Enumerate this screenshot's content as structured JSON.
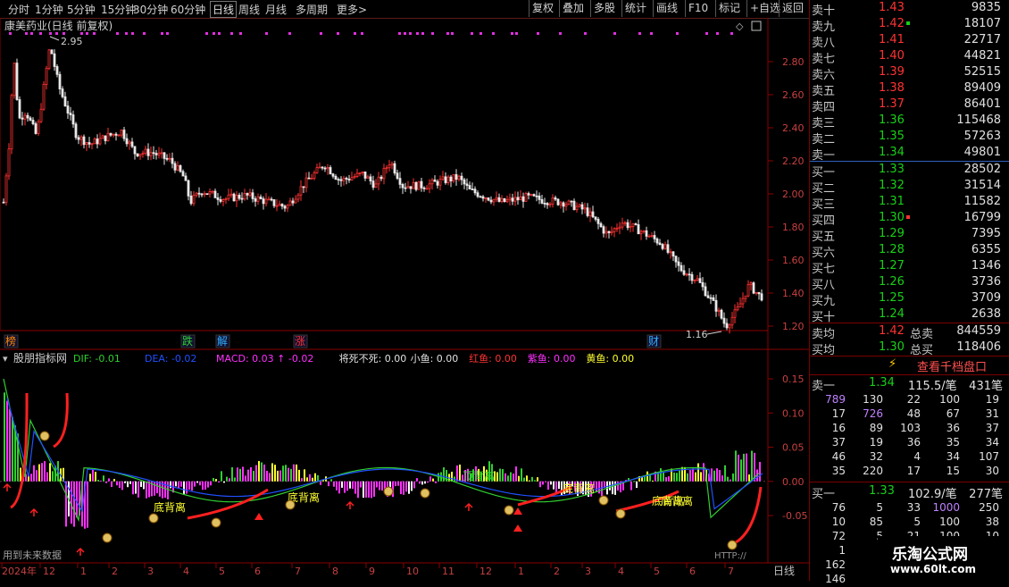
{
  "toolbar": {
    "periods": [
      "分时",
      "1分钟",
      "5分钟",
      "15分钟",
      "30分钟",
      "60分钟",
      "日线",
      "周线",
      "月线",
      "多周期",
      "更多>"
    ],
    "active": "日线",
    "right_buttons": [
      "复权",
      "叠加",
      "多股",
      "统计",
      "画线",
      "F10",
      "标记",
      "+自选",
      "返回"
    ]
  },
  "main_chart": {
    "title": "康美药业(日线 前复权)",
    "high_label": "2.95",
    "low_label": "1.16",
    "y_ticks": [
      "2.80",
      "2.60",
      "2.40",
      "2.20",
      "2.00",
      "1.80",
      "1.60",
      "1.40",
      "1.20"
    ],
    "markers": [
      "榜",
      "跌",
      "解",
      "涨",
      "财"
    ]
  },
  "indicator": {
    "name": "股朋指标网",
    "fields": [
      {
        "label": "DIF: -0.01",
        "color": "#30d030"
      },
      {
        "label": "DEA: -0.02",
        "color": "#2050ff"
      },
      {
        "label": "MACD: 0.03 ↑ -0.02",
        "color": "#ff30ff"
      },
      {
        "label": "将死不死: 0.00",
        "color": "#e0e0e0"
      },
      {
        "label": "小鱼: 0.00",
        "color": "#e0e0e0"
      },
      {
        "label": "红鱼: 0.00",
        "color": "#ff3232"
      },
      {
        "label": "紫鱼: 0.00",
        "color": "#ff30ff"
      },
      {
        "label": "黄鱼: 0.00",
        "color": "#ffff30"
      }
    ],
    "y_ticks": [
      "0.15",
      "0.10",
      "0.05",
      "0.00",
      "-0.05"
    ],
    "annotations": [
      "底背离",
      "底背离",
      "顶背离",
      "底背离",
      "底背离",
      "底背离"
    ],
    "footer_left": "用到未来数据",
    "footer_right": "HTTP://"
  },
  "x_axis": {
    "labels": [
      "2024年",
      "12",
      "1",
      "2",
      "3",
      "4",
      "5",
      "6",
      "7",
      "8",
      "9",
      "10",
      "11",
      "12",
      "1",
      "2",
      "3",
      "4",
      "5",
      "6",
      "7"
    ],
    "period": "日线"
  },
  "order_book": {
    "sell": [
      {
        "label": "卖十",
        "price": "1.43",
        "vol": "9835"
      },
      {
        "label": "卖九",
        "price": "1.42",
        "vol": "18107"
      },
      {
        "label": "卖八",
        "price": "1.41",
        "vol": "22717"
      },
      {
        "label": "卖七",
        "price": "1.40",
        "vol": "44821"
      },
      {
        "label": "卖六",
        "price": "1.39",
        "vol": "52515"
      },
      {
        "label": "卖五",
        "price": "1.38",
        "vol": "89409"
      },
      {
        "label": "卖四",
        "price": "1.37",
        "vol": "86401"
      },
      {
        "label": "卖三",
        "price": "1.36",
        "vol": "115468"
      },
      {
        "label": "卖二",
        "price": "1.35",
        "vol": "57263"
      },
      {
        "label": "卖一",
        "price": "1.34",
        "vol": "49801"
      }
    ],
    "buy": [
      {
        "label": "买一",
        "price": "1.33",
        "vol": "28502"
      },
      {
        "label": "买二",
        "price": "1.32",
        "vol": "31514"
      },
      {
        "label": "买三",
        "price": "1.31",
        "vol": "11582"
      },
      {
        "label": "买四",
        "price": "1.30",
        "vol": "16799"
      },
      {
        "label": "买五",
        "price": "1.29",
        "vol": "7395"
      },
      {
        "label": "买六",
        "price": "1.28",
        "vol": "6355"
      },
      {
        "label": "买七",
        "price": "1.27",
        "vol": "1346"
      },
      {
        "label": "买八",
        "price": "1.26",
        "vol": "3736"
      },
      {
        "label": "买九",
        "price": "1.25",
        "vol": "3709"
      },
      {
        "label": "买十",
        "price": "1.24",
        "vol": "2638"
      }
    ],
    "avg": [
      {
        "label": "卖均",
        "price": "1.42",
        "tlabel": "总卖",
        "vol": "844559"
      },
      {
        "label": "买均",
        "price": "1.30",
        "tlabel": "总买",
        "vol": "118406"
      }
    ],
    "button": "查看千档盘口"
  },
  "sell_queue": {
    "label": "卖一",
    "price": "1.34",
    "per": "115.5/笔",
    "count": "431笔",
    "rows": [
      [
        "789",
        "130",
        "22",
        "100",
        "19"
      ],
      [
        "17",
        "726",
        "48",
        "67",
        "31"
      ],
      [
        "16",
        "89",
        "103",
        "36",
        "37"
      ],
      [
        "37",
        "19",
        "36",
        "35",
        "34"
      ],
      [
        "46",
        "32",
        "4",
        "34",
        "107"
      ],
      [
        "35",
        "220",
        "17",
        "15",
        "30"
      ]
    ]
  },
  "buy_queue": {
    "label": "买一",
    "price": "1.33",
    "per": "102.9/笔",
    "count": "277笔",
    "rows": [
      [
        "76",
        "5",
        "33",
        "1000",
        "250"
      ],
      [
        "10",
        "85",
        "5",
        "100",
        "38"
      ],
      [
        "72",
        "5",
        "21",
        "100",
        "10"
      ],
      [
        "1",
        "",
        "",
        "",
        ""
      ],
      [
        "162",
        "",
        "",
        "",
        ""
      ],
      [
        "146",
        "",
        "",
        "",
        ""
      ]
    ]
  },
  "watermark": {
    "title": "乐淘公式网",
    "url": "www.60lt.com"
  },
  "colors": {
    "up": "#ff3232",
    "down": "#18d018",
    "grid": "#8a0000",
    "dif": "#30d030",
    "dea": "#2050ff"
  }
}
